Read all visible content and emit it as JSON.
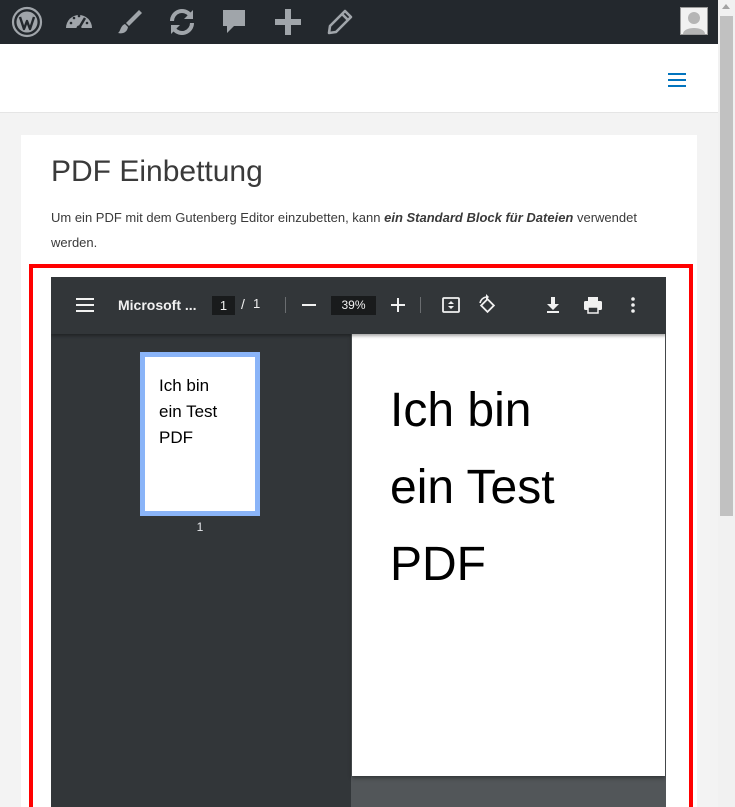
{
  "adminbar": {
    "icons": [
      "wordpress-icon",
      "dashboard-icon",
      "customize-icon",
      "updates-icon",
      "comments-icon",
      "new-content-icon",
      "edit-icon"
    ]
  },
  "header": {
    "menu_icon": "hamburger-menu-icon"
  },
  "article": {
    "title": "PDF Einbettung",
    "intro_before": "Um ein PDF mit dem Gutenberg Editor einzubetten, kann ",
    "intro_em": "ein Standard Block für Dateien",
    "intro_after": " verwendet werden."
  },
  "viewer": {
    "doc_title": "Microsoft ...",
    "current_page": "1",
    "separator": "/",
    "total_pages": "1",
    "zoom": "39%",
    "thumb_text": [
      "Ich bin",
      "ein Test",
      "PDF"
    ],
    "thumb_label": "1",
    "page_text": [
      "Ich bin",
      "ein Test",
      "PDF"
    ]
  },
  "colors": {
    "adminbar_bg": "#23282d",
    "accent": "#0274be",
    "highlight": "#ff0000",
    "viewer_toolbar": "#323639",
    "viewer_bg": "#525659",
    "thumb_border": "#8ab4f8"
  }
}
